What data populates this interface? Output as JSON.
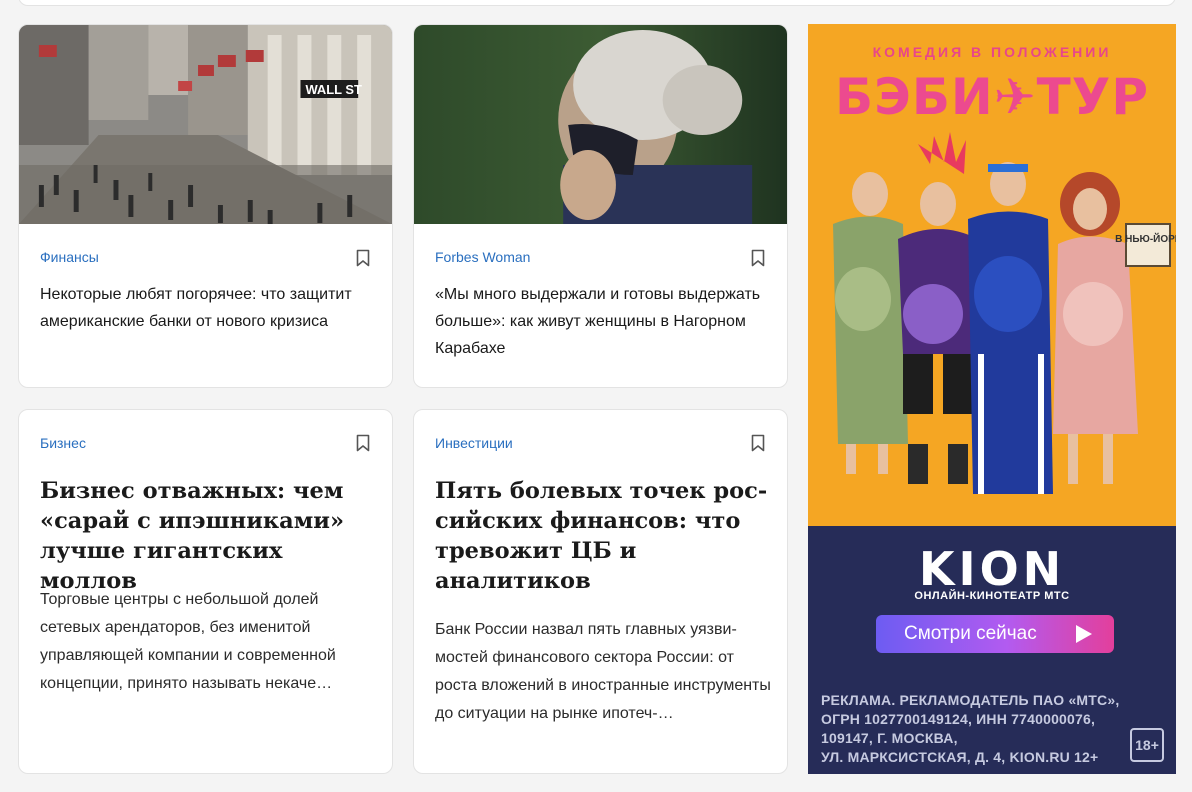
{
  "cards": [
    {
      "rubric": "Финансы",
      "title": "Некоторые любят погорячее: что защи­тит американские банки от нового кризиса"
    },
    {
      "rubric": "Forbes Woman",
      "title": "«Мы много выдержали и готовы выдер­жать больше»: как живут женщины в Нагорном Карабахе"
    },
    {
      "rubric": "Бизнес",
      "title": "Бизнес отважных: чем «сарай с ипэшниками» лучше гигантских моллов",
      "lead": "Торговые центры с небольшой долей сетевых арендаторов, без именитой управляющей компании и современной концепции, принято называть некаче…"
    },
    {
      "rubric": "Инвестиции",
      "title": "Пять болевых точек рос­сийских финансов: что тревожит ЦБ и аналитиков",
      "lead": "Банк России назвал пять главных уязви­мостей финансового сектора России: от роста вложений в иностранные инстру­менты до ситуации на рынке ипотеч-…"
    }
  ],
  "ad": {
    "subtitle": "Комедия в положении",
    "title": "БЭБИ✈ТУР",
    "sign": "В НЬЮ-ЙОРК",
    "brand": "KION",
    "brand_sub": "ОНЛАЙН-КИНОТЕАТР МТС",
    "cta": "Смотри сейчас",
    "legal": "РЕКЛАМА. РЕКЛАМОДАТЕЛЬ ПАО «МТС»,\nОГРН 1027700149124, ИНН 7740000076,\n109147, Г. МОСКВА,\nУЛ. МАРКСИСТСКАЯ, Д. 4, KION.RU 12+",
    "age": "18+",
    "wall_street_sign": "WALL ST"
  },
  "icons": {
    "bookmark": "bookmark-icon",
    "play": "play-icon"
  },
  "colors": {
    "rubric": "#2a6fbf",
    "ad_orange": "#f5a623",
    "ad_pink": "#ec4a8f",
    "ad_navy": "#262c58"
  }
}
